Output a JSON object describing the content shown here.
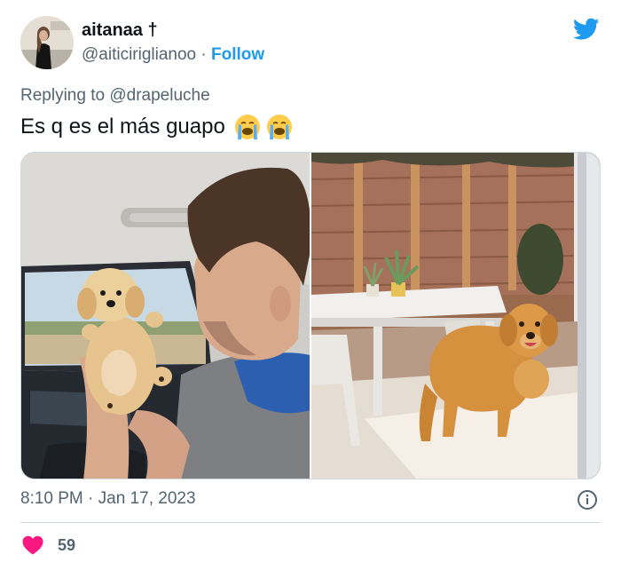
{
  "author": {
    "display_name": "aitanaa †",
    "handle": "@aiticiriglianoо",
    "separator": " · ",
    "follow_label": "Follow"
  },
  "reply": {
    "prefix": "Replying to ",
    "handle": "@drapeluche"
  },
  "tweet": {
    "text": "Es q es el más guapo",
    "emojis": [
      "loudly-crying-face",
      "loudly-crying-face"
    ]
  },
  "footer": {
    "timestamp": "8:10 PM · Jan 17, 2023",
    "like_count": "59"
  },
  "colors": {
    "accent": "#1d9bf0",
    "like": "#f91880",
    "muted": "#536471",
    "text": "#0f1419"
  },
  "icons": {
    "brand": "twitter-bird-icon",
    "info": "info-icon",
    "like": "heart-icon"
  }
}
